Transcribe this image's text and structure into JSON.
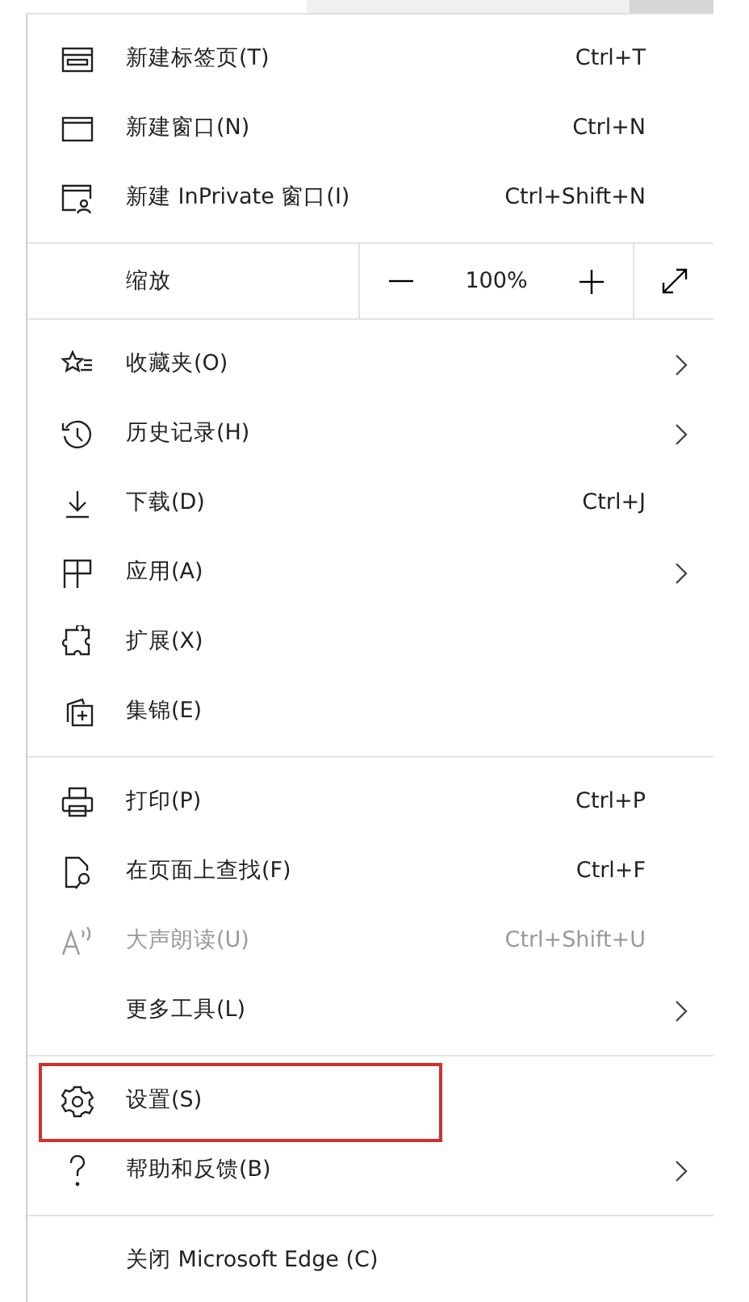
{
  "menu": {
    "groups": [
      {
        "items": [
          {
            "kind": "item",
            "label": "新建标签页(T)",
            "shortcut": "Ctrl+T",
            "submenu": false,
            "disabled": false,
            "highlighted": false
          },
          {
            "kind": "item",
            "label": "新建窗口(N)",
            "shortcut": "Ctrl+N",
            "submenu": false,
            "disabled": false,
            "highlighted": false
          },
          {
            "kind": "item",
            "label": "新建 InPrivate 窗口(I)",
            "shortcut": "Ctrl+Shift+N",
            "submenu": false,
            "disabled": false,
            "highlighted": false
          }
        ]
      },
      {
        "items": [
          {
            "kind": "zoom",
            "label": "缩放",
            "value": "100%"
          }
        ]
      },
      {
        "items": [
          {
            "kind": "item",
            "label": "收藏夹(O)",
            "submenu": true,
            "disabled": false,
            "highlighted": false
          },
          {
            "kind": "item",
            "label": "历史记录(H)",
            "submenu": true,
            "disabled": false,
            "highlighted": false
          },
          {
            "kind": "item",
            "label": "下载(D)",
            "shortcut": "Ctrl+J",
            "submenu": false,
            "disabled": false,
            "highlighted": false
          },
          {
            "kind": "item",
            "label": "应用(A)",
            "submenu": true,
            "disabled": false,
            "highlighted": false
          },
          {
            "kind": "item",
            "label": "扩展(X)",
            "submenu": false,
            "disabled": false,
            "highlighted": false
          },
          {
            "kind": "item",
            "label": "集锦(E)",
            "submenu": false,
            "disabled": false,
            "highlighted": false
          }
        ]
      },
      {
        "items": [
          {
            "kind": "item",
            "label": "打印(P)",
            "shortcut": "Ctrl+P",
            "submenu": false,
            "disabled": false,
            "highlighted": false
          },
          {
            "kind": "item",
            "label": "在页面上查找(F)",
            "shortcut": "Ctrl+F",
            "submenu": false,
            "disabled": false,
            "highlighted": false
          },
          {
            "kind": "item",
            "label": "大声朗读(U)",
            "shortcut": "Ctrl+Shift+U",
            "submenu": false,
            "disabled": true,
            "highlighted": false
          },
          {
            "kind": "item",
            "label": "更多工具(L)",
            "submenu": true,
            "disabled": false,
            "highlighted": false
          }
        ]
      },
      {
        "items": [
          {
            "kind": "item",
            "label": "设置(S)",
            "submenu": false,
            "disabled": false,
            "highlighted": true
          },
          {
            "kind": "item",
            "label": "帮助和反馈(B)",
            "submenu": true,
            "disabled": false,
            "highlighted": false
          }
        ]
      },
      {
        "items": [
          {
            "kind": "item",
            "label": "关闭 Microsoft Edge (C)",
            "submenu": false,
            "disabled": false,
            "highlighted": false
          }
        ]
      }
    ]
  }
}
